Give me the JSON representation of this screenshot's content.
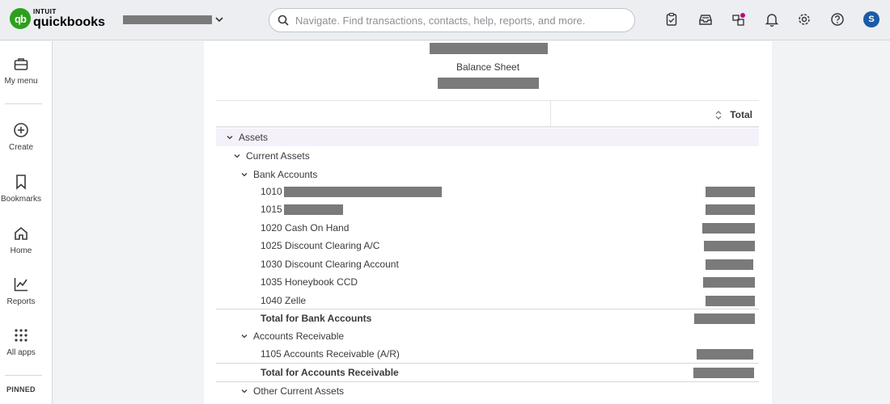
{
  "topbar": {
    "logo_line1": "INTUIT",
    "logo_line2": "quickbooks",
    "logo_mark": "qb",
    "search_placeholder": "Navigate. Find transactions, contacts, help, reports, and more.",
    "avatar_initial": "S",
    "icons": [
      "clipboard-icon",
      "inbox-icon",
      "apps-notification-icon",
      "bell-icon",
      "gear-icon",
      "help-icon"
    ]
  },
  "sidebar": {
    "items": [
      {
        "label": "My menu",
        "icon": "briefcase-icon"
      },
      {
        "label": "Create",
        "icon": "plus-circle-icon"
      },
      {
        "label": "Bookmarks",
        "icon": "bookmark-icon"
      },
      {
        "label": "Home",
        "icon": "home-icon"
      },
      {
        "label": "Reports",
        "icon": "chart-icon"
      },
      {
        "label": "All apps",
        "icon": "grid-icon"
      }
    ],
    "pinned_label": "PINNED"
  },
  "report": {
    "title": "Balance Sheet",
    "total_column": "Total",
    "rows": [
      {
        "label": "Assets",
        "kind": "section",
        "expanded": true
      },
      {
        "label": "Current Assets",
        "kind": "section",
        "expanded": true
      },
      {
        "label": "Bank Accounts",
        "kind": "section",
        "expanded": true
      },
      {
        "label": "1010",
        "kind": "account"
      },
      {
        "label": "1015",
        "kind": "account"
      },
      {
        "label": "1020 Cash On Hand",
        "kind": "account"
      },
      {
        "label": "1025 Discount Clearing A/C",
        "kind": "account"
      },
      {
        "label": "1030 Discount Clearing Account",
        "kind": "account"
      },
      {
        "label": "1035 Honeybook CCD",
        "kind": "account"
      },
      {
        "label": "1040 Zelle",
        "kind": "account"
      },
      {
        "label": "Total for Bank Accounts",
        "kind": "total"
      },
      {
        "label": "Accounts Receivable",
        "kind": "section",
        "expanded": true
      },
      {
        "label": "1105 Accounts Receivable (A/R)",
        "kind": "account"
      },
      {
        "label": "Total for Accounts Receivable",
        "kind": "total"
      },
      {
        "label": "Other Current Assets",
        "kind": "section",
        "expanded": true
      }
    ]
  },
  "colors": {
    "brand_green": "#2ca01c",
    "avatar_blue": "#1c5aa6",
    "redaction": "#7a7a7a",
    "row_highlight": "#f5f1fb"
  }
}
